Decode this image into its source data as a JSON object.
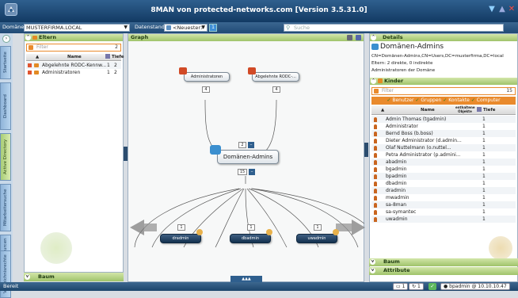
{
  "window": {
    "title": "8MAN von protected-networks.com [Version 3.5.31.0]"
  },
  "toolbar": {
    "domain_label": "Domäne:",
    "domain_value": "MUSTERFIRMA.LOCAL",
    "datastand_label": "Datenstand:",
    "datastand_value": "<Neuester>",
    "datastand_badge": "1",
    "search_placeholder": "Suche"
  },
  "sidebar_tabs": [
    "Startseite",
    "Dashboard",
    "Active Directory",
    "Mitarbeitersuche",
    "Ressourcen",
    "Verzeichnisrechte"
  ],
  "left_panel": {
    "header": "Eltern",
    "filter_placeholder": "Filter",
    "filter_count": "2",
    "columns": [
      "Name",
      "Tiefe"
    ],
    "rows": [
      {
        "name": "Abgelehnte RODC-Kennw...",
        "depth1": "1",
        "depth2": "2"
      },
      {
        "name": "Administratoren",
        "depth1": "1",
        "depth2": "2"
      }
    ],
    "footer": "Baum"
  },
  "graph": {
    "header": "Graph",
    "nodes": {
      "top_left": "Administratoren",
      "top_right": "Abgelehnte RODC-...",
      "center": "Domänen-Admins",
      "bottom_1": "dradmin",
      "bottom_2": "dbadmin",
      "bottom_3": "uwadmin"
    },
    "badges": {
      "top_left": "4",
      "top_right": "4",
      "center_parent": "2",
      "center_child": "15",
      "bottom_1": "1",
      "bottom_2": "1",
      "bottom_3": "1"
    },
    "pager": "▲▲▲"
  },
  "details": {
    "header": "Details",
    "title": "Domänen-Admins",
    "dn": "CN=Domänen-Admins,CN=Users,DC=musterfirma,DC=local",
    "parents": "Eltern: 2 direkte, 0 indirekte",
    "description": "Administratoren der Domäne"
  },
  "children": {
    "header": "Kinder",
    "filter_placeholder": "Filter",
    "filter_count": "15",
    "chips": [
      "Benutzer",
      "Gruppen",
      "Kontakte",
      "Computer"
    ],
    "columns": [
      "Name",
      "enthaltene Objekte",
      "Tiefe"
    ],
    "rows": [
      {
        "name": "Admin Thomas (tgadmin)",
        "depth": "1"
      },
      {
        "name": "Administrator",
        "depth": "1"
      },
      {
        "name": "Bernd Boss (b.boss)",
        "depth": "1"
      },
      {
        "name": "Dieter Administrator (d.admin...",
        "depth": "1"
      },
      {
        "name": "Olaf Nuttelmann (o.nuttel...",
        "depth": "1"
      },
      {
        "name": "Petra Administrator (p.admini...",
        "depth": "1"
      },
      {
        "name": "abadmin",
        "depth": "1"
      },
      {
        "name": "bgadmin",
        "depth": "1"
      },
      {
        "name": "bpadmin",
        "depth": "1"
      },
      {
        "name": "dbadmin",
        "depth": "1"
      },
      {
        "name": "dradmin",
        "depth": "1"
      },
      {
        "name": "mwadmin",
        "depth": "1"
      },
      {
        "name": "sa-8man",
        "depth": "1"
      },
      {
        "name": "sa-symantec",
        "depth": "1"
      },
      {
        "name": "uwadmin",
        "depth": "1"
      }
    ],
    "footer_tree": "Baum",
    "footer_attr": "Attribute"
  },
  "status": {
    "text": "Bereit",
    "count_a": "1",
    "count_b": "1",
    "user": "bpadmin @ 10.10.10.47"
  }
}
